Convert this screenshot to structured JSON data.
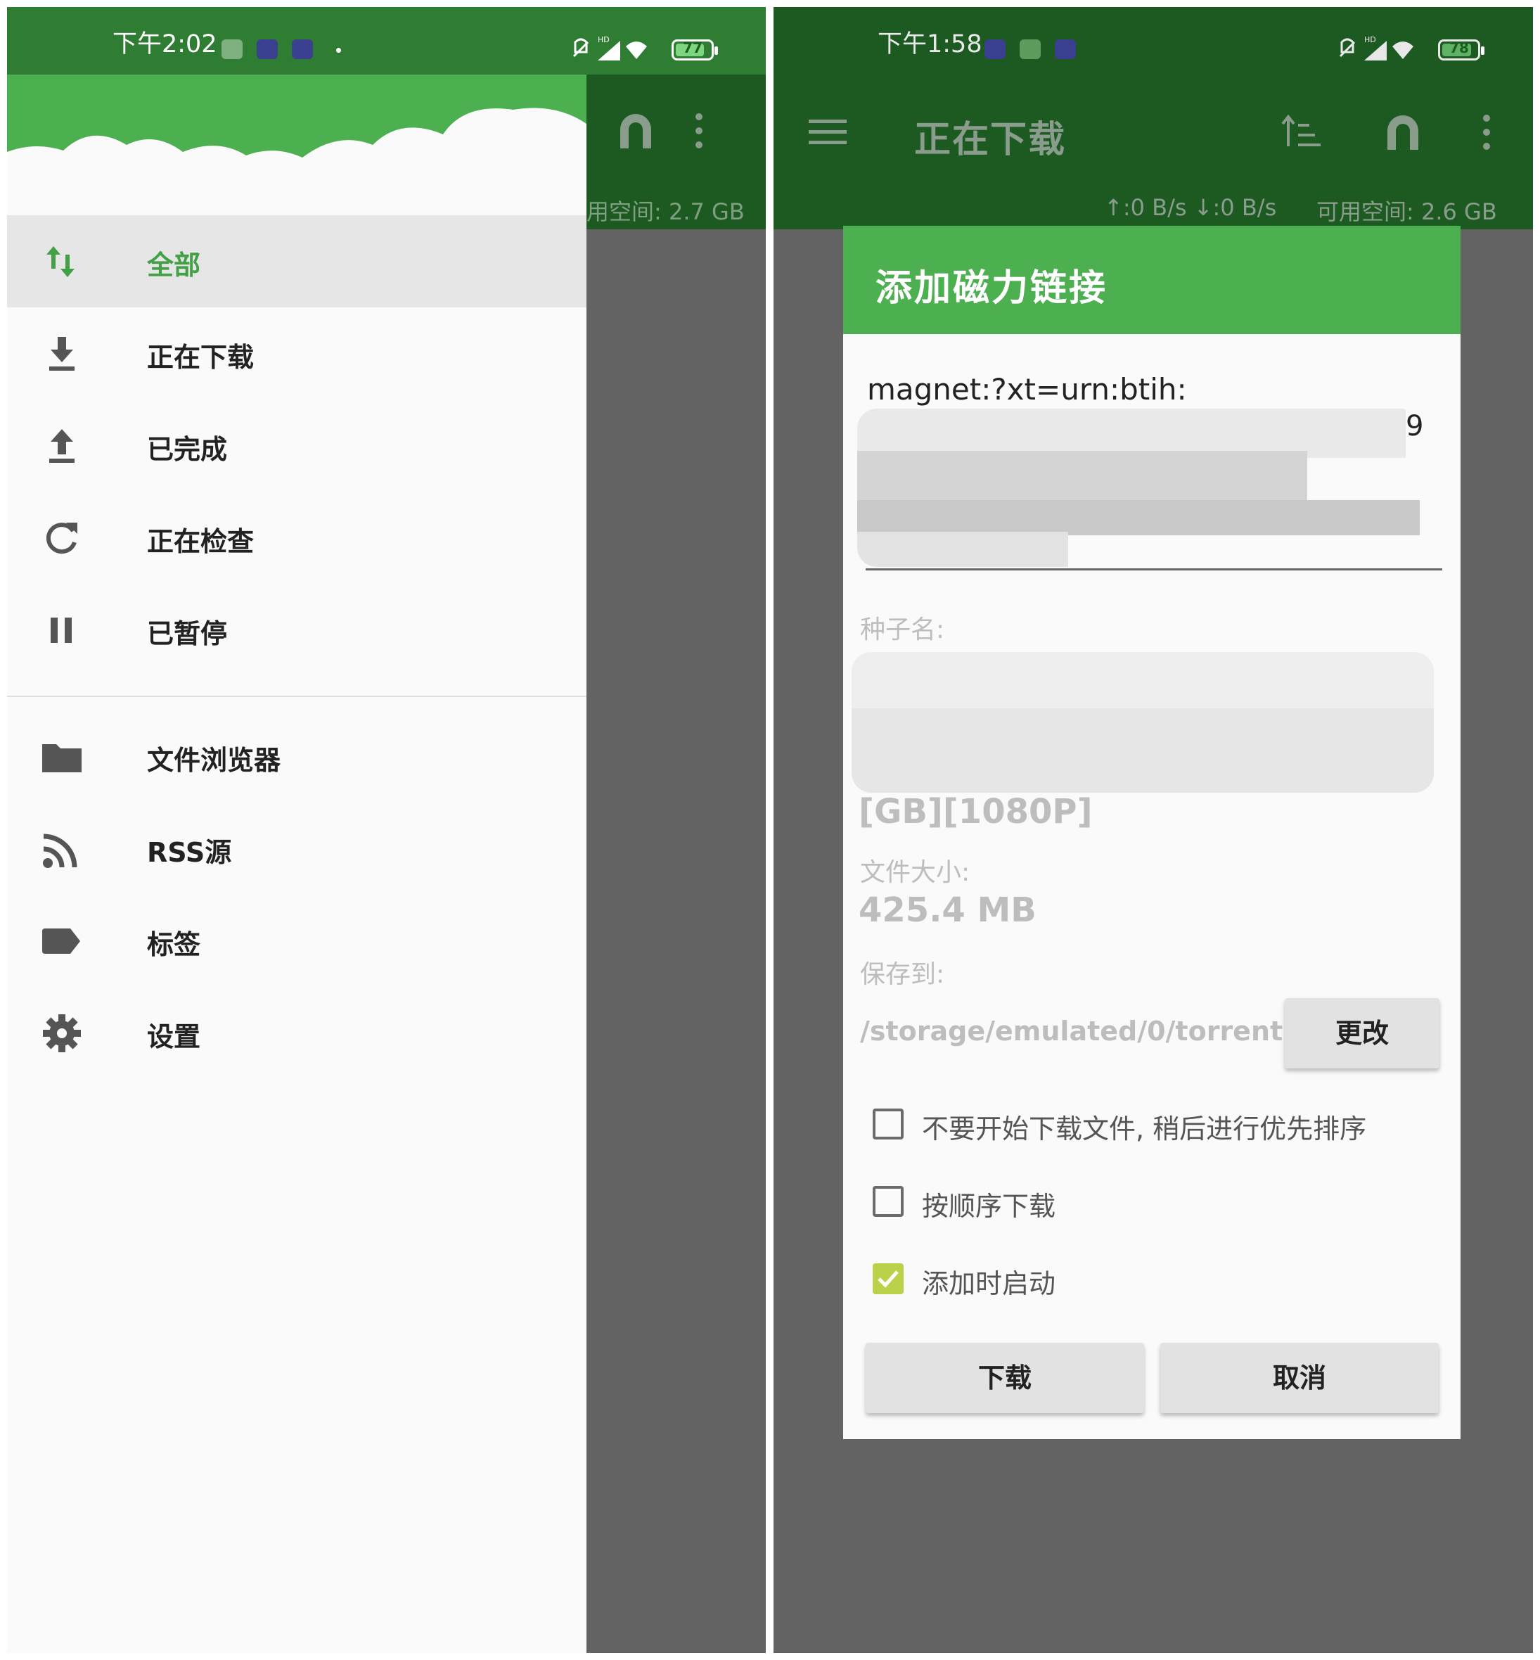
{
  "left_screen": {
    "status_bar": {
      "time": "下午2:02",
      "battery": "77"
    },
    "toolbar_free_space": "用空间: 2.7 GB",
    "drawer": {
      "items": [
        {
          "label": "全部",
          "icon": "sort-arrows-icon",
          "active": true
        },
        {
          "label": "正在下载",
          "icon": "download-icon"
        },
        {
          "label": "已完成",
          "icon": "upload-icon"
        },
        {
          "label": "正在检查",
          "icon": "refresh-icon"
        },
        {
          "label": "已暂停",
          "icon": "pause-icon"
        }
      ],
      "secondary_items": [
        {
          "label": "文件浏览器",
          "icon": "folder-icon"
        },
        {
          "label": "RSS源",
          "icon": "rss-icon"
        },
        {
          "label": "标签",
          "icon": "tag-icon"
        },
        {
          "label": "设置",
          "icon": "gear-icon"
        }
      ]
    }
  },
  "right_screen": {
    "status_bar": {
      "time": "下午1:58",
      "battery": "78"
    },
    "toolbar": {
      "title": "正在下载",
      "speed": "↑:0 B/s  ↓:0 B/s",
      "free_space": "可用空间: 2.6 GB"
    },
    "dialog": {
      "title": "添加磁力链接",
      "magnet_value": "magnet:?xt=urn:btih:",
      "magnet_tail": "9",
      "torrent_name_label": "种子名:",
      "torrent_name_tail": "[GB][1080P]",
      "file_size_label": "文件大小:",
      "file_size_value": "425.4 MB",
      "save_to_label": "保存到:",
      "save_path": "/storage/emulated/0/torrent",
      "change_button": "更改",
      "options": [
        {
          "label": "不要开始下载文件, 稍后进行优先排序",
          "checked": false
        },
        {
          "label": "按顺序下载",
          "checked": false
        },
        {
          "label": "添加时启动",
          "checked": true
        }
      ],
      "download_button": "下载",
      "cancel_button": "取消"
    }
  },
  "colors": {
    "primary": "#4caf50",
    "primary_dark": "#2e7d32",
    "scrim": "#636363",
    "checkbox_accent": "#b9d24a"
  }
}
